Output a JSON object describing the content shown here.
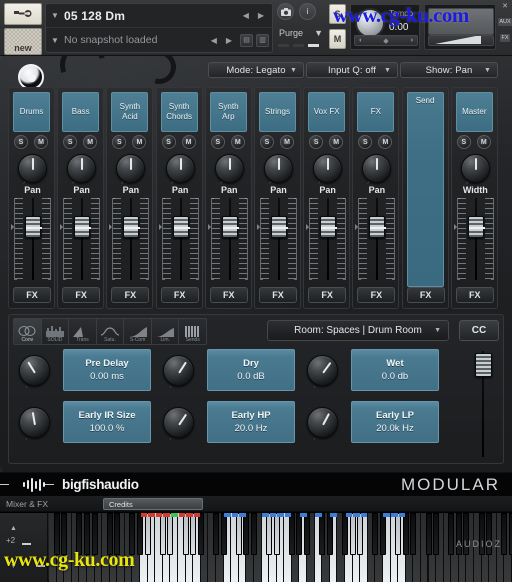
{
  "header": {
    "instrument_name": "05 128 Dm",
    "snapshot_name": "No snapshot loaded",
    "purge_label": "Purge",
    "tempo_label": "Tempo",
    "tempo_value": "0.00",
    "new_label": "new",
    "solo_label": "S",
    "mute_label": "M",
    "wrench_icon": "wrench-icon",
    "camera_icon": "camera-icon",
    "info_icon": "info-icon",
    "save_icon": "save-icon",
    "copy_icon": "copy-icon",
    "prev_icon": "prev-arrow-icon",
    "next_icon": "next-arrow-icon",
    "close_icon": "close-icon",
    "side_tags": [
      "AUX",
      "FX"
    ]
  },
  "watermarks": {
    "top": "www.cg-ku.com",
    "bottom": "www.cg-ku.com",
    "top_color": "#1c1ce0",
    "bottom_color": "#e9e60d"
  },
  "toolbar": {
    "mode": "Mode: Legato",
    "input_q": "Input Q: off",
    "show": "Show: Pan"
  },
  "mixer": {
    "solo_label": "S",
    "mute_label": "M",
    "fx_label": "FX",
    "channels": [
      {
        "name": [
          "Drums"
        ],
        "control": "Pan",
        "has_sm": true,
        "tall_blue": false
      },
      {
        "name": [
          "Bass"
        ],
        "control": "Pan",
        "has_sm": true,
        "tall_blue": false
      },
      {
        "name": [
          "Synth",
          "Acid"
        ],
        "control": "Pan",
        "has_sm": true,
        "tall_blue": false
      },
      {
        "name": [
          "Synth",
          "Chords"
        ],
        "control": "Pan",
        "has_sm": true,
        "tall_blue": false
      },
      {
        "name": [
          "Synth",
          "Arp"
        ],
        "control": "Pan",
        "has_sm": true,
        "tall_blue": false
      },
      {
        "name": [
          "Strings"
        ],
        "control": "Pan",
        "has_sm": true,
        "tall_blue": false
      },
      {
        "name": [
          "Vox FX"
        ],
        "control": "Pan",
        "has_sm": true,
        "tall_blue": false
      },
      {
        "name": [
          "FX"
        ],
        "control": "Pan",
        "has_sm": true,
        "tall_blue": false
      },
      {
        "name": [
          "Send"
        ],
        "control": "",
        "has_sm": false,
        "tall_blue": true
      },
      {
        "name": [
          "Master"
        ],
        "control": "Width",
        "has_sm": true,
        "tall_blue": false
      }
    ]
  },
  "fx": {
    "tabs": [
      {
        "label": "Conv",
        "icon": "convolution-icon",
        "active": true
      },
      {
        "label": "SOLID",
        "icon": "eq-icon",
        "active": false
      },
      {
        "label": "Trans",
        "icon": "transient-icon",
        "active": false
      },
      {
        "label": "Satu.",
        "icon": "saturation-icon",
        "active": false
      },
      {
        "label": "S-Com",
        "icon": "compressor-icon",
        "active": false
      },
      {
        "label": "Lim.",
        "icon": "limiter-icon",
        "active": false
      },
      {
        "label": "Sends",
        "icon": "sends-icon",
        "active": false
      }
    ],
    "preset": "Room: Spaces | Drum Room",
    "cc_label": "CC",
    "params": [
      {
        "name": "Pre Delay",
        "value": "0.00 ms"
      },
      {
        "name": "Dry",
        "value": "0.0 dB"
      },
      {
        "name": "Wet",
        "value": "0.0 db"
      },
      {
        "name": "Early IR Size",
        "value": "100.0 %"
      },
      {
        "name": "Early HP",
        "value": "20.0 Hz"
      },
      {
        "name": "Early LP",
        "value": "20.0k Hz"
      }
    ]
  },
  "brand": {
    "vendor": "bigfishaudio",
    "product": "MODULAR",
    "waveform_icon": "waveform-icon"
  },
  "tabbar": {
    "active_tab": "Mixer & FX",
    "credits": "Credits"
  },
  "keyboard": {
    "octave_up": "▲",
    "octave_label": "+2",
    "octave_down": "▼",
    "audioz_tag": "AUDIOZ"
  },
  "colors": {
    "accent_blue": "#4a7a90",
    "panel_dark": "#232528",
    "text_light": "#e3e7ea"
  }
}
